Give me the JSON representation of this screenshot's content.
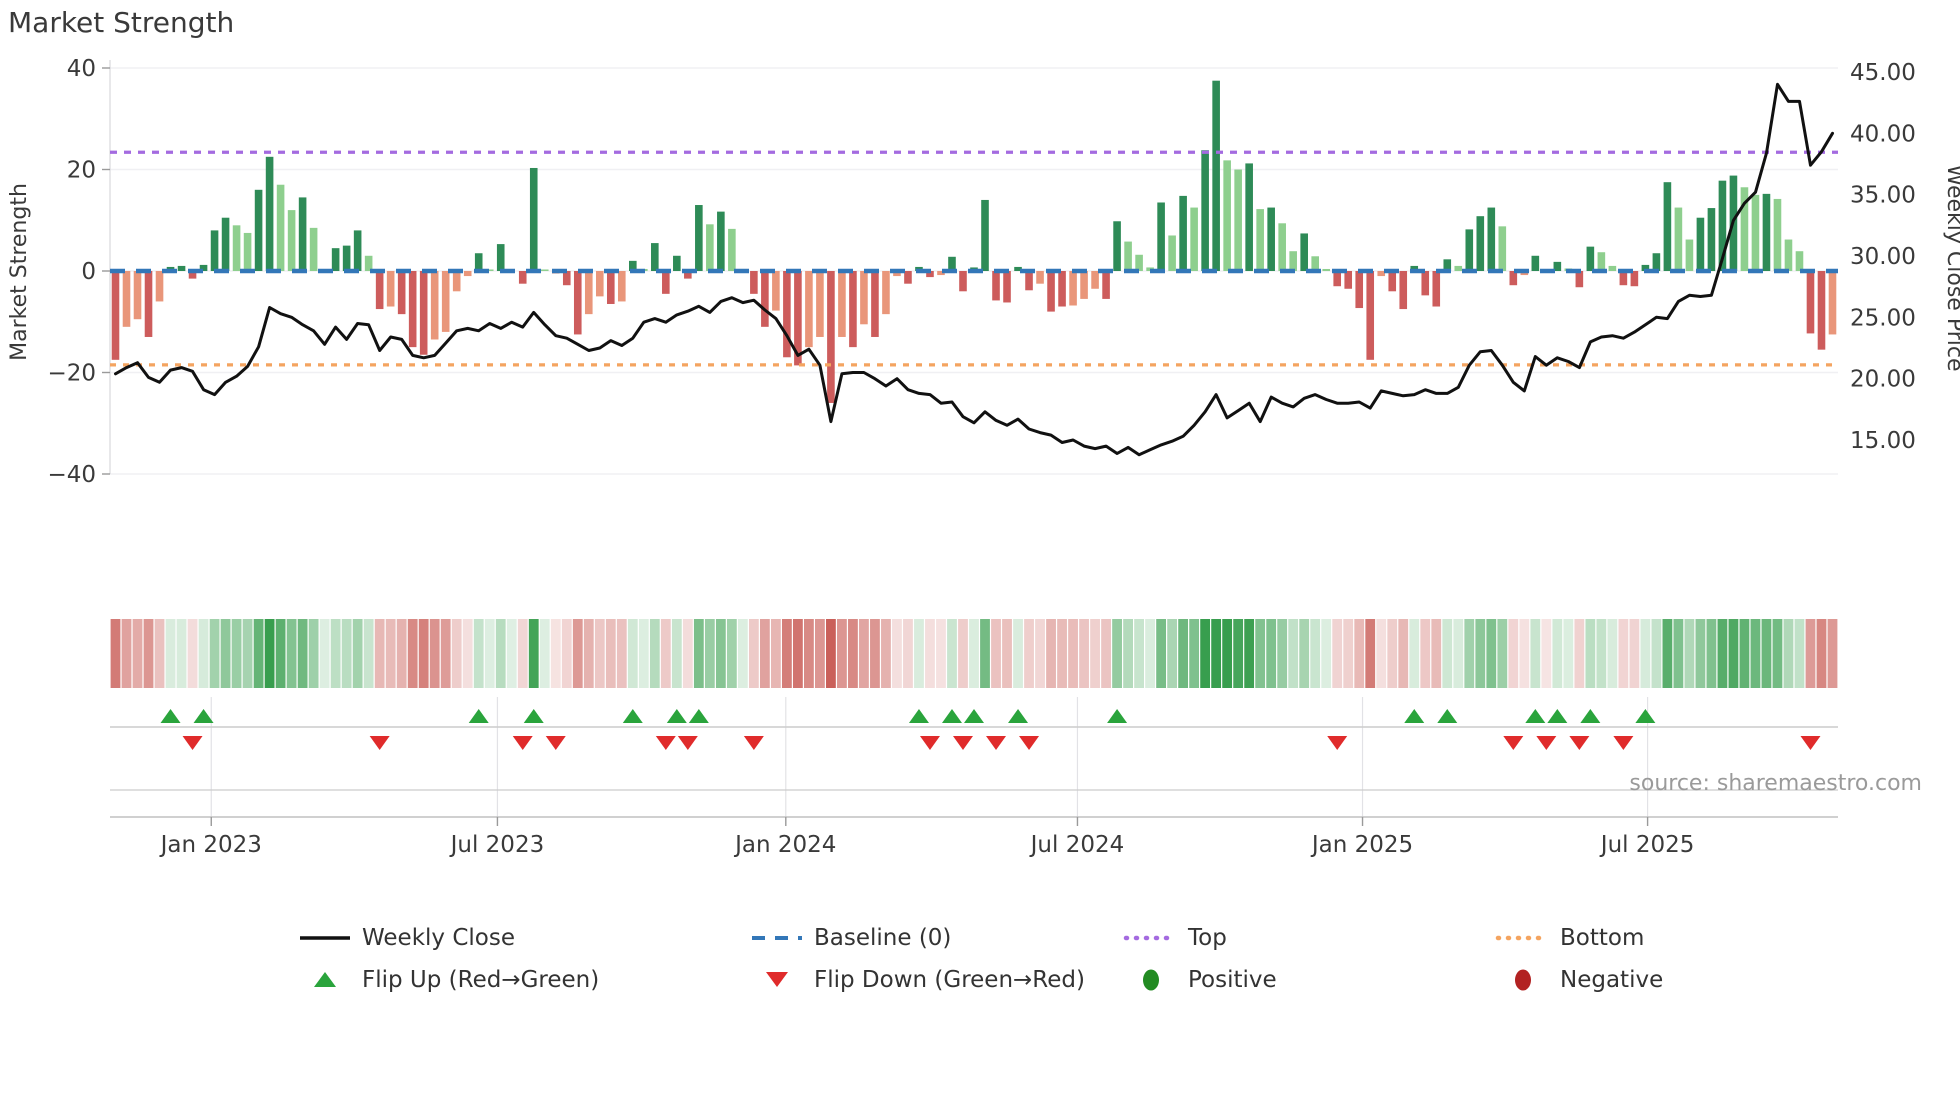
{
  "title": "Market Strength",
  "source": "source: sharemaestro.com",
  "left_axis": {
    "label": "Market Strength",
    "ticks": [
      {
        "label": "40",
        "v": 40
      },
      {
        "label": "20",
        "v": 20
      },
      {
        "label": "0",
        "v": 0
      },
      {
        "label": "−20",
        "v": -20
      },
      {
        "label": "−40",
        "v": -40
      }
    ]
  },
  "right_axis": {
    "label": "Weekly Close Price",
    "ticks": [
      {
        "label": "45.00",
        "v": 45
      },
      {
        "label": "40.00",
        "v": 40
      },
      {
        "label": "35.00",
        "v": 35
      },
      {
        "label": "30.00",
        "v": 30
      },
      {
        "label": "25.00",
        "v": 25
      },
      {
        "label": "20.00",
        "v": 20
      },
      {
        "label": "15.00",
        "v": 15
      }
    ]
  },
  "x_ticks": [
    {
      "label": "Jan 2023",
      "week": 9.2
    },
    {
      "label": "Jul 2023",
      "week": 35.2
    },
    {
      "label": "Jan 2024",
      "week": 61.4
    },
    {
      "label": "Jul 2024",
      "week": 87.9
    },
    {
      "label": "Jan 2025",
      "week": 113.8
    },
    {
      "label": "Jul 2025",
      "week": 139.7
    }
  ],
  "legend": {
    "rows": [
      [
        {
          "swatch": "line",
          "label": "Weekly Close"
        },
        {
          "swatch": "dash-blue",
          "label": "Baseline (0)"
        },
        {
          "swatch": "dot-purple",
          "label": "Top"
        },
        {
          "swatch": "dot-orange",
          "label": "Bottom"
        }
      ],
      [
        {
          "swatch": "tri-up",
          "label": "Flip Up (Red→Green)"
        },
        {
          "swatch": "tri-down",
          "label": "Flip Down (Green→Red)"
        },
        {
          "swatch": "dot-pos",
          "label": "Positive"
        },
        {
          "swatch": "dot-neg",
          "label": "Negative"
        }
      ]
    ]
  },
  "colors": {
    "bar_dark_green": "#2e8b57",
    "bar_light_green": "#8ecf8e",
    "bar_dark_red": "#cd5c5c",
    "bar_salmon": "#e9967a",
    "price_line": "#111111",
    "baseline": "#3377b8",
    "top_line": "#a46be0",
    "bottom_line": "#f4a460",
    "flip_up": "#2aa43c",
    "flip_down": "#e02b2b",
    "positive_dot": "#228b22",
    "negative_dot": "#b22222",
    "grid": "#f0f0f3",
    "axis_text": "#3a3a3a",
    "source_text": "#9a9a9a"
  },
  "chart_data": {
    "type": "bar+line+heatmap",
    "weeks": 157,
    "period": "Nov 2022 - Oct 2025 (weekly)",
    "strength_axis": {
      "min": -40,
      "max": 40
    },
    "price_axis": {
      "min": 15,
      "max": 45
    },
    "baseline": 0,
    "top_level": 23.4,
    "bottom_level": -18.5,
    "strength_values": [
      -17.5,
      -11,
      -9.5,
      -13,
      -6,
      0.8,
      1,
      -1.5,
      1.2,
      8,
      10.5,
      9,
      7.5,
      16,
      22.5,
      17,
      12,
      14.5,
      8.5,
      0.3,
      4.5,
      5,
      8,
      3,
      -7.5,
      -7,
      -8.5,
      -15,
      -16.5,
      -13.5,
      -12,
      -4,
      -1,
      3.5,
      0.3,
      5.3,
      0,
      -2.5,
      20.3,
      0.3,
      -0.5,
      -2.8,
      -12.5,
      -8.5,
      -5,
      -6.5,
      -6,
      2,
      0.4,
      5.5,
      -4.5,
      3,
      -1.5,
      13,
      9.2,
      11.7,
      8.3,
      0.4,
      -4.5,
      -11,
      -7.8,
      -17,
      -18.6,
      -15,
      -13,
      -26,
      -13,
      -15,
      -10.5,
      -13,
      -8.5,
      -1,
      -2.5,
      0.8,
      -1.2,
      -0.8,
      2.8,
      -4,
      0.7,
      14,
      -5.8,
      -6.2,
      0.8,
      -3.8,
      -2.5,
      -8,
      -7,
      -6.8,
      -5.5,
      -3.5,
      -5.5,
      9.8,
      5.8,
      3.2,
      0.7,
      13.5,
      7,
      14.8,
      12.5,
      23.8,
      37.5,
      21.8,
      20,
      21.2,
      12.2,
      12.5,
      9.4,
      3.9,
      7.4,
      2.9,
      0.4,
      -3,
      -3.5,
      -7.3,
      -17.5,
      -1,
      -4,
      -7.5,
      1,
      -4.8,
      -7,
      2.3,
      1,
      8.2,
      10.8,
      12.5,
      8.8,
      -2.8,
      -0.8,
      3,
      -0.2,
      1.8,
      0.5,
      -3.2,
      4.8,
      3.7,
      1,
      -2.8,
      -3,
      1.2,
      3.5,
      17.5,
      12.5,
      6.2,
      10.5,
      12.4,
      17.8,
      18.8,
      16.5,
      15,
      15.2,
      14.2,
      6.2,
      3.9,
      -12.3,
      -15.5,
      -12.5
    ],
    "strength_shades": [
      "dr",
      "sr",
      "sr",
      "dr",
      "sr",
      "dg",
      "dg",
      "dr",
      "dg",
      "dg",
      "dg",
      "lg",
      "lg",
      "dg",
      "dg",
      "lg",
      "lg",
      "dg",
      "lg",
      "lg",
      "dg",
      "dg",
      "dg",
      "lg",
      "dr",
      "sr",
      "dr",
      "dr",
      "dr",
      "sr",
      "sr",
      "sr",
      "sr",
      "dg",
      "lg",
      "dg",
      "lg",
      "dr",
      "dg",
      "lg",
      "sr",
      "dr",
      "dr",
      "sr",
      "sr",
      "dr",
      "sr",
      "dg",
      "lg",
      "dg",
      "dr",
      "dg",
      "dr",
      "dg",
      "lg",
      "dg",
      "lg",
      "lg",
      "dr",
      "dr",
      "sr",
      "dr",
      "dr",
      "sr",
      "sr",
      "dr",
      "sr",
      "dr",
      "sr",
      "dr",
      "sr",
      "sr",
      "dr",
      "dg",
      "dr",
      "sr",
      "dg",
      "dr",
      "dg",
      "dg",
      "dr",
      "dr",
      "dg",
      "dr",
      "sr",
      "dr",
      "dr",
      "sr",
      "sr",
      "sr",
      "dr",
      "dg",
      "lg",
      "lg",
      "lg",
      "dg",
      "lg",
      "dg",
      "lg",
      "dg",
      "dg",
      "lg",
      "lg",
      "dg",
      "lg",
      "dg",
      "lg",
      "lg",
      "dg",
      "lg",
      "lg",
      "dr",
      "dr",
      "dr",
      "dr",
      "sr",
      "dr",
      "dr",
      "dg",
      "dr",
      "dr",
      "dg",
      "lg",
      "dg",
      "dg",
      "dg",
      "lg",
      "dr",
      "sr",
      "dg",
      "dr",
      "dg",
      "lg",
      "dr",
      "dg",
      "lg",
      "lg",
      "dr",
      "dr",
      "dg",
      "dg",
      "dg",
      "lg",
      "lg",
      "dg",
      "dg",
      "dg",
      "dg",
      "lg",
      "lg",
      "dg",
      "lg",
      "lg",
      "lg",
      "dr",
      "dr",
      "sr"
    ],
    "price_values": [
      20.4,
      20.9,
      21.3,
      20.1,
      19.7,
      20.7,
      20.9,
      20.6,
      19.1,
      18.7,
      19.7,
      20.2,
      21.0,
      22.6,
      25.8,
      25.3,
      25.0,
      24.4,
      23.9,
      22.8,
      24.2,
      23.2,
      24.5,
      24.4,
      22.3,
      23.4,
      23.2,
      21.9,
      21.7,
      21.9,
      22.9,
      23.9,
      24.1,
      23.9,
      24.5,
      24.1,
      24.6,
      24.2,
      25.4,
      24.4,
      23.5,
      23.3,
      22.8,
      22.3,
      22.5,
      23.1,
      22.7,
      23.3,
      24.6,
      24.9,
      24.6,
      25.2,
      25.5,
      25.9,
      25.4,
      26.3,
      26.6,
      26.2,
      26.4,
      25.6,
      24.9,
      23.5,
      21.9,
      22.4,
      21.1,
      16.5,
      20.4,
      20.5,
      20.5,
      20.0,
      19.4,
      20.0,
      19.1,
      18.8,
      18.7,
      18.0,
      18.1,
      16.9,
      16.4,
      17.3,
      16.6,
      16.2,
      16.7,
      15.9,
      15.6,
      15.4,
      14.8,
      15.0,
      14.5,
      14.3,
      14.5,
      13.9,
      14.4,
      13.8,
      14.2,
      14.6,
      14.9,
      15.3,
      16.2,
      17.3,
      18.7,
      16.8,
      17.4,
      18.0,
      16.5,
      18.5,
      18.0,
      17.7,
      18.4,
      18.7,
      18.3,
      18.0,
      18.0,
      18.1,
      17.6,
      19.0,
      18.8,
      18.6,
      18.7,
      19.1,
      18.8,
      18.8,
      19.3,
      21.1,
      22.2,
      22.3,
      21.1,
      19.7,
      19.0,
      21.8,
      21.1,
      21.7,
      21.4,
      20.9,
      23.0,
      23.4,
      23.5,
      23.3,
      23.8,
      24.4,
      25.0,
      24.9,
      26.3,
      26.8,
      26.7,
      26.8,
      29.8,
      32.9,
      34.3,
      35.2,
      38.4,
      44.0,
      42.6,
      42.6,
      37.4,
      38.5,
      40.0
    ],
    "flip_up_weeks": [
      5,
      8,
      33,
      38,
      47,
      51,
      53,
      73,
      76,
      78,
      82,
      91,
      118,
      121,
      129,
      131,
      134,
      139
    ],
    "flip_down_weeks": [
      7,
      24,
      37,
      40,
      50,
      52,
      58,
      74,
      77,
      80,
      83,
      111,
      127,
      130,
      133,
      137,
      154
    ]
  }
}
